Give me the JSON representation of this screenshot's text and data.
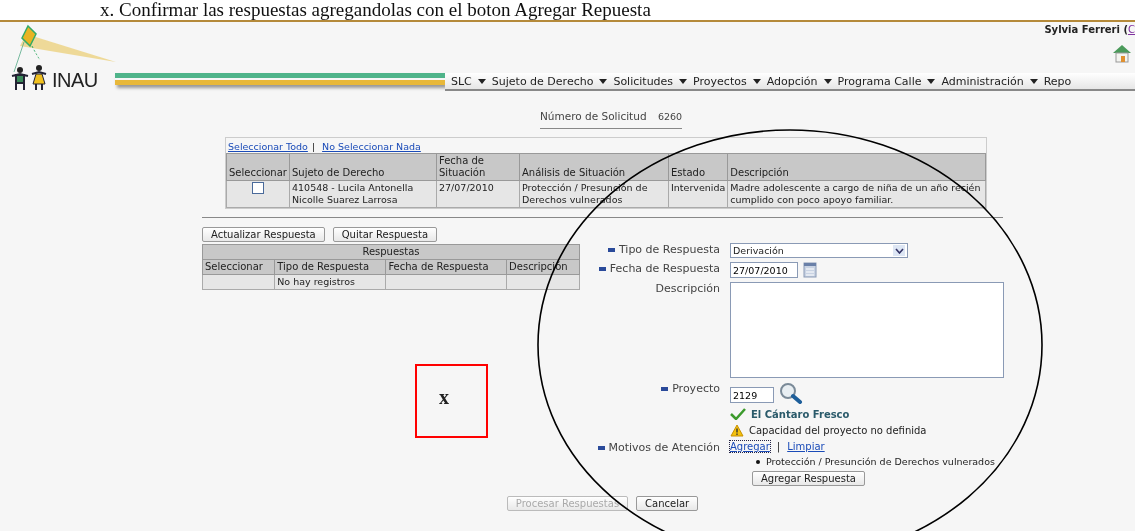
{
  "annotation": {
    "instruction": "x. Confirmar las respuestas agregandolas con el boton Agregar Repuesta",
    "marker": "x"
  },
  "header": {
    "logo": "INAU",
    "user_name": "Sylvia Ferreri (",
    "user_link": "C"
  },
  "menu": [
    {
      "label": "SLC",
      "caret": true
    },
    {
      "label": "Sujeto de Derecho",
      "caret": true
    },
    {
      "label": "Solicitudes",
      "caret": true
    },
    {
      "label": "Proyectos",
      "caret": true
    },
    {
      "label": "Adopción",
      "caret": true
    },
    {
      "label": "Programa Calle",
      "caret": true
    },
    {
      "label": "Administración",
      "caret": true
    },
    {
      "label": "Repo",
      "caret": false
    }
  ],
  "solicitud": {
    "label": "Número de Solicitud",
    "value": "6260"
  },
  "selection_links": {
    "links": [
      "Seleccionar Todo",
      "No Seleccionar Nada"
    ],
    "separator": "|"
  },
  "situations": {
    "columns": [
      "Seleccionar",
      "Sujeto de Derecho",
      "Fecha de Situación",
      "Análisis de Situación",
      "Estado",
      "Descripción"
    ],
    "rows": [
      {
        "checked": false,
        "cells": [
          "",
          "410548 - Lucila Antonella Nicolle Suarez Larrosa",
          "27/07/2010",
          "Protección / Presunción de Derechos vulnerados",
          "Intervenida",
          "Madre adolescente a cargo de niña de un año recién cumplido con poco apoyo familiar."
        ]
      }
    ]
  },
  "response_buttons": [
    {
      "label": "Actualizar Respuesta",
      "disabled": false
    },
    {
      "label": "Quitar Respuesta",
      "disabled": false
    }
  ],
  "responses": {
    "title": "Respuestas",
    "columns": [
      "Seleccionar",
      "Tipo de Respuesta",
      "Fecha de Respuesta",
      "Descripción"
    ],
    "empty": "No hay registros"
  },
  "form": [
    {
      "kind": "select",
      "label": "Tipo de Respuesta",
      "required": true,
      "value": "Derivación"
    },
    {
      "kind": "date",
      "label": "Fecha de Respuesta",
      "required": true,
      "value": "27/07/2010"
    },
    {
      "kind": "textarea",
      "label": "Descripción",
      "required": false
    },
    {
      "kind": "lookup",
      "label": "Proyecto",
      "required": true,
      "value": "2129",
      "result": "El Cántaro Fresco",
      "warning": "Capacidad del proyecto no definida"
    },
    {
      "kind": "links",
      "label": "Motivos de Atención",
      "required": true,
      "links": [
        "Agregar",
        "Limpiar"
      ],
      "separator": "|",
      "items": [
        "Protección / Presunción de Derechos vulnerados"
      ],
      "button": "Agregar Respuesta"
    }
  ],
  "buttons": [
    {
      "label": "Procesar Respuestas",
      "disabled": true
    },
    {
      "label": "Cancelar",
      "disabled": false
    }
  ]
}
